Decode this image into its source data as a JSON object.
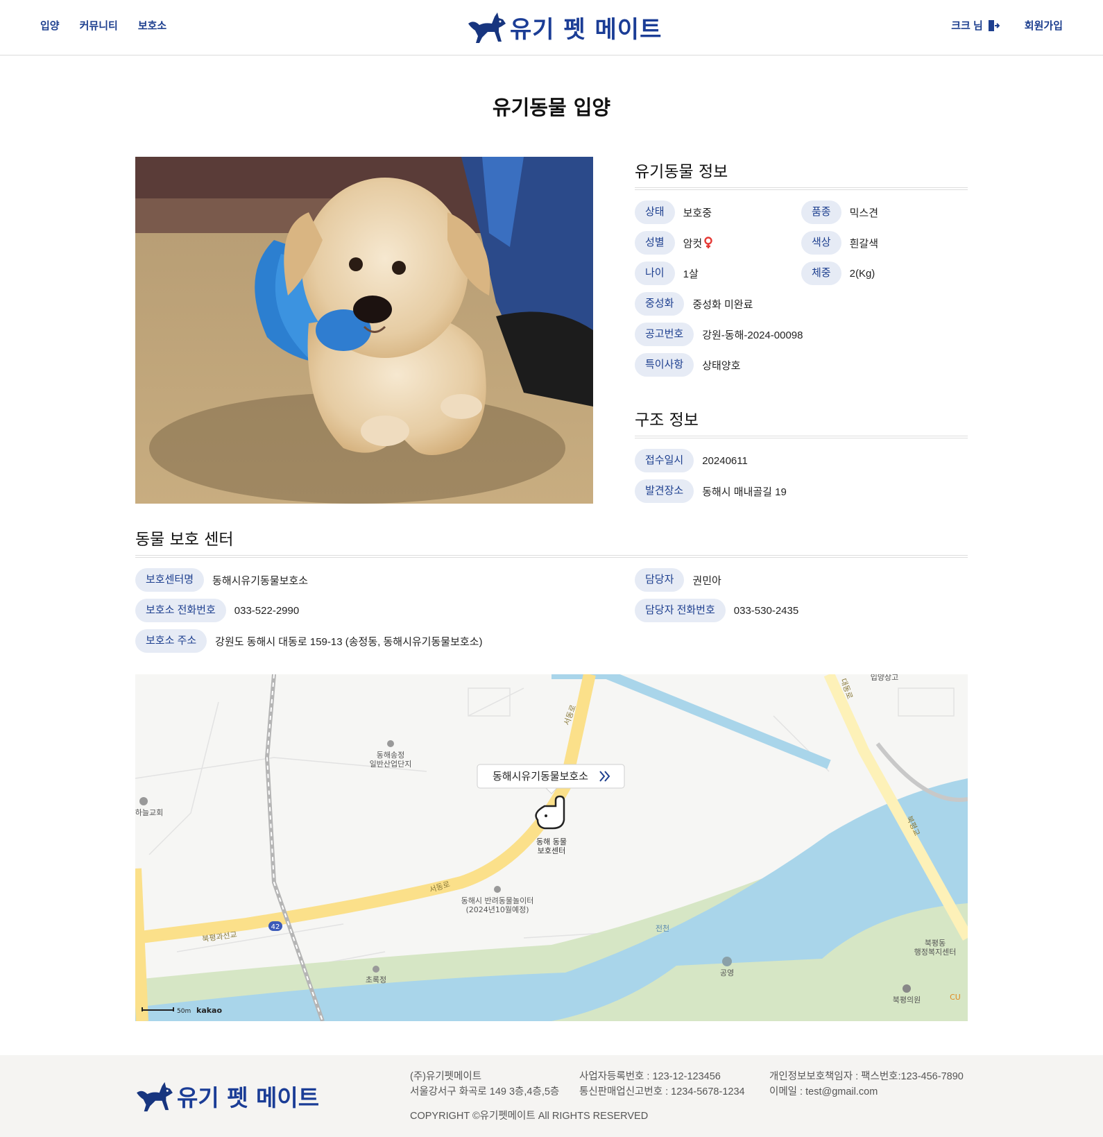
{
  "header": {
    "nav": [
      "입양",
      "커뮤니티",
      "보호소"
    ],
    "logo_text": "유기 펫 메이트",
    "user_label": "크크 님",
    "signup_label": "회원가입"
  },
  "page_title": "유기동물 입양",
  "animal_info": {
    "heading": "유기동물 정보",
    "status": {
      "label": "상태",
      "value": "보호중"
    },
    "breed": {
      "label": "품종",
      "value": "믹스견"
    },
    "sex": {
      "label": "성별",
      "value": "암컷"
    },
    "color": {
      "label": "색상",
      "value": "흰갈색"
    },
    "age": {
      "label": "나이",
      "value": "1살"
    },
    "weight": {
      "label": "체중",
      "value": "2(Kg)"
    },
    "neuter": {
      "label": "중성화",
      "value": "중성화 미완료"
    },
    "notice": {
      "label": "공고번호",
      "value": "강원-동해-2024-00098"
    },
    "special": {
      "label": "특이사항",
      "value": "상태양호"
    }
  },
  "rescue_info": {
    "heading": "구조 정보",
    "date": {
      "label": "접수일시",
      "value": "20240611"
    },
    "place": {
      "label": "발견장소",
      "value": "동해시 매내골길 19"
    }
  },
  "center": {
    "heading": "동물 보호 센터",
    "name": {
      "label": "보호센터명",
      "value": "동해시유기동물보호소"
    },
    "phone": {
      "label": "보호소 전화번호",
      "value": "033-522-2990"
    },
    "address": {
      "label": "보호소 주소",
      "value": "강원도 동해시 대동로 159-13 (송정동, 동해시유기동물보호소)"
    },
    "manager": {
      "label": "담당자",
      "value": "권민아"
    },
    "manager_phone": {
      "label": "담당자 전화번호",
      "value": "033-530-2435"
    }
  },
  "map": {
    "marker_label": "동해시유기동물보호소",
    "poi_center": "동해 동물\n보호센터",
    "poi_industrial": "동해송정\n일반산업단지",
    "poi_church": "하늘교회",
    "poi_playground": "동해시 반려동물놀이터\n(2024년10월예정)",
    "poi_chorok": "초록정",
    "poi_bukpyeong": "북평동\n행정복지센터",
    "poi_clinic": "북평의원",
    "poi_parking": "공영",
    "poi_top": "입양상고",
    "road_seodong": "서동로",
    "road_seodong2": "서동로",
    "road_bridge": "북평과선교",
    "road_42": "42",
    "road_daedong": "대동로",
    "road_daedong2": "북평교",
    "river": "전천",
    "cu": "CU",
    "scale": "50m",
    "brand": "kakao",
    "colors": {
      "river": "#a9d5ea",
      "green": "#d6e6c5",
      "road": "#fbe08a"
    }
  },
  "footer": {
    "logo_text": "유기 펫 메이트",
    "company": "(주)유기펫메이트",
    "address": "서울강서구 화곡로 149 3층,4층,5층",
    "biz_no": "사업자등록번호 : 123-12-123456",
    "mail_order": "통신판매업신고번호 : 1234-5678-1234",
    "privacy": "개인정보보호책임자 : 팩스번호:123-456-7890",
    "email": "이메일 : test@gmail.com",
    "copyright": "COPYRIGHT ©유기펫메이트 All RIGHTS RESERVED"
  },
  "icons": {
    "logo": "dog-logo-icon",
    "logout": "logout-icon",
    "female": "female-icon",
    "marker_arrow": "double-chevron-right-icon"
  }
}
